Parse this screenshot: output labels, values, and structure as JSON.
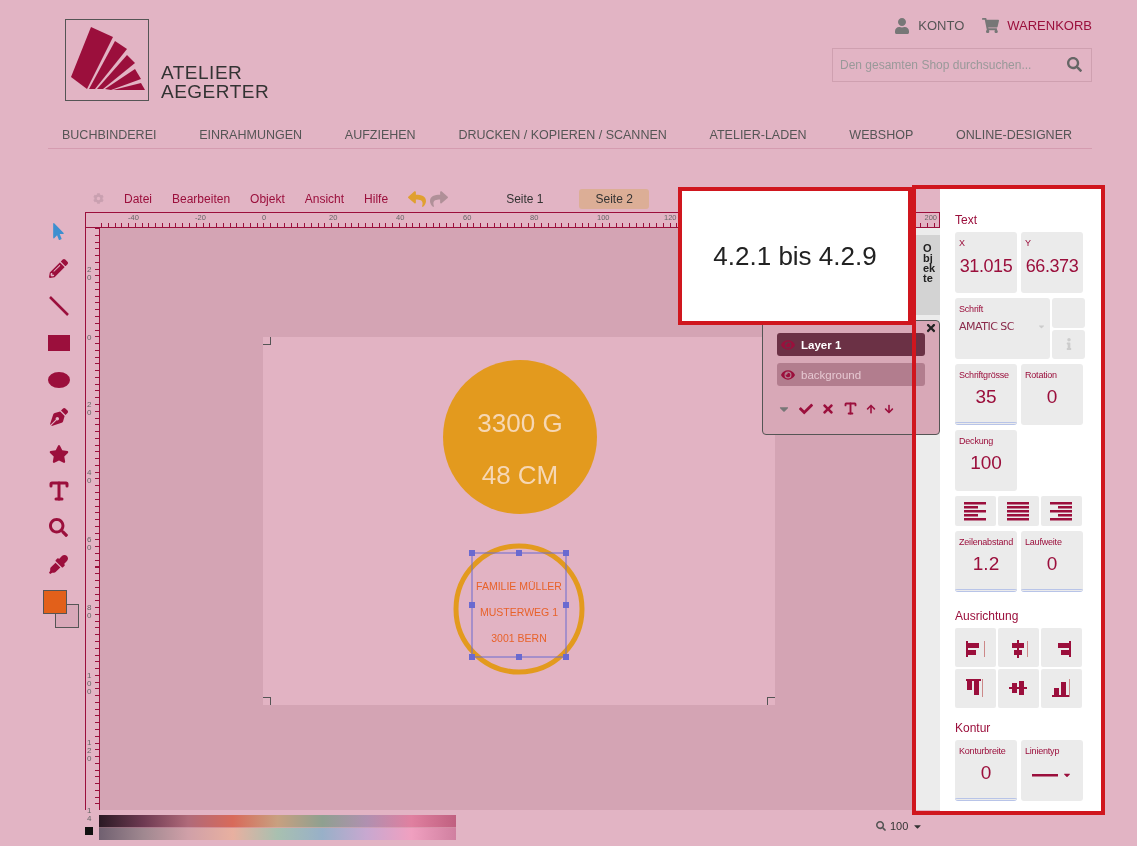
{
  "header": {
    "logo_lines": [
      "ATELIER",
      "AEGERTER"
    ],
    "account": "KONTO",
    "cart": "WARENKORB",
    "search": {
      "placeholder": "Den gesamten Shop durchsuchen..."
    }
  },
  "nav": [
    "BUCHBINDEREI",
    "EINRAHMUNGEN",
    "AUFZIEHEN",
    "DRUCKEN / KOPIEREN / SCANNEN",
    "ATELIER-LADEN",
    "WEBSHOP",
    "ONLINE-DESIGNER"
  ],
  "editor": {
    "menu": [
      "Datei",
      "Bearbeiten",
      "Objekt",
      "Ansicht",
      "Hilfe"
    ],
    "pages": [
      {
        "label": "Seite 1",
        "selected": false
      },
      {
        "label": "Seite 2",
        "selected": true
      }
    ],
    "tools": [
      {
        "kind": "select",
        "selected": true
      },
      {
        "kind": "pencil",
        "selected": false
      },
      {
        "kind": "line",
        "selected": false
      },
      {
        "kind": "rect",
        "selected": false
      },
      {
        "kind": "ellipse",
        "selected": false
      },
      {
        "kind": "pen",
        "selected": false
      },
      {
        "kind": "star",
        "selected": false
      },
      {
        "kind": "text",
        "selected": false
      },
      {
        "kind": "zoom",
        "selected": false
      },
      {
        "kind": "eyedropper",
        "selected": false
      }
    ],
    "ruler_h": [
      "-40",
      "-20",
      "0",
      "20",
      "40",
      "60",
      "80",
      "100",
      "120",
      "200"
    ],
    "ruler_v": [
      "20",
      "0",
      "20",
      "40",
      "60",
      "80",
      "100",
      "120",
      "14"
    ],
    "design": {
      "badge": [
        "3300 G",
        "48 CM"
      ],
      "address": [
        "FAMILIE MÜLLER",
        "MUSTERWEG 1",
        "3001 BERN"
      ]
    },
    "layers": [
      {
        "name": "Layer 1",
        "selected": true
      },
      {
        "name": "background",
        "selected": false
      }
    ],
    "objects_tab": "Objekte",
    "zoom": "100"
  },
  "annotation": "4.2.1 bis 4.2.9",
  "properties": {
    "title": "Text",
    "x": {
      "label": "X",
      "value": "31.015"
    },
    "y": {
      "label": "Y",
      "value": "66.373"
    },
    "font": {
      "label": "Schrift",
      "value": "AMATIC SC"
    },
    "size": {
      "label": "Schriftgrösse",
      "value": "35"
    },
    "rotation": {
      "label": "Rotation",
      "value": "0"
    },
    "opacity": {
      "label": "Deckung",
      "value": "100"
    },
    "line_height": {
      "label": "Zeilenabstand",
      "value": "1.2"
    },
    "tracking": {
      "label": "Laufweite",
      "value": "0"
    },
    "alignment_title": "Ausrichtung",
    "contour_title": "Kontur",
    "stroke_width": {
      "label": "Konturbreite",
      "value": "0"
    },
    "line_type": {
      "label": "Linientyp"
    }
  }
}
